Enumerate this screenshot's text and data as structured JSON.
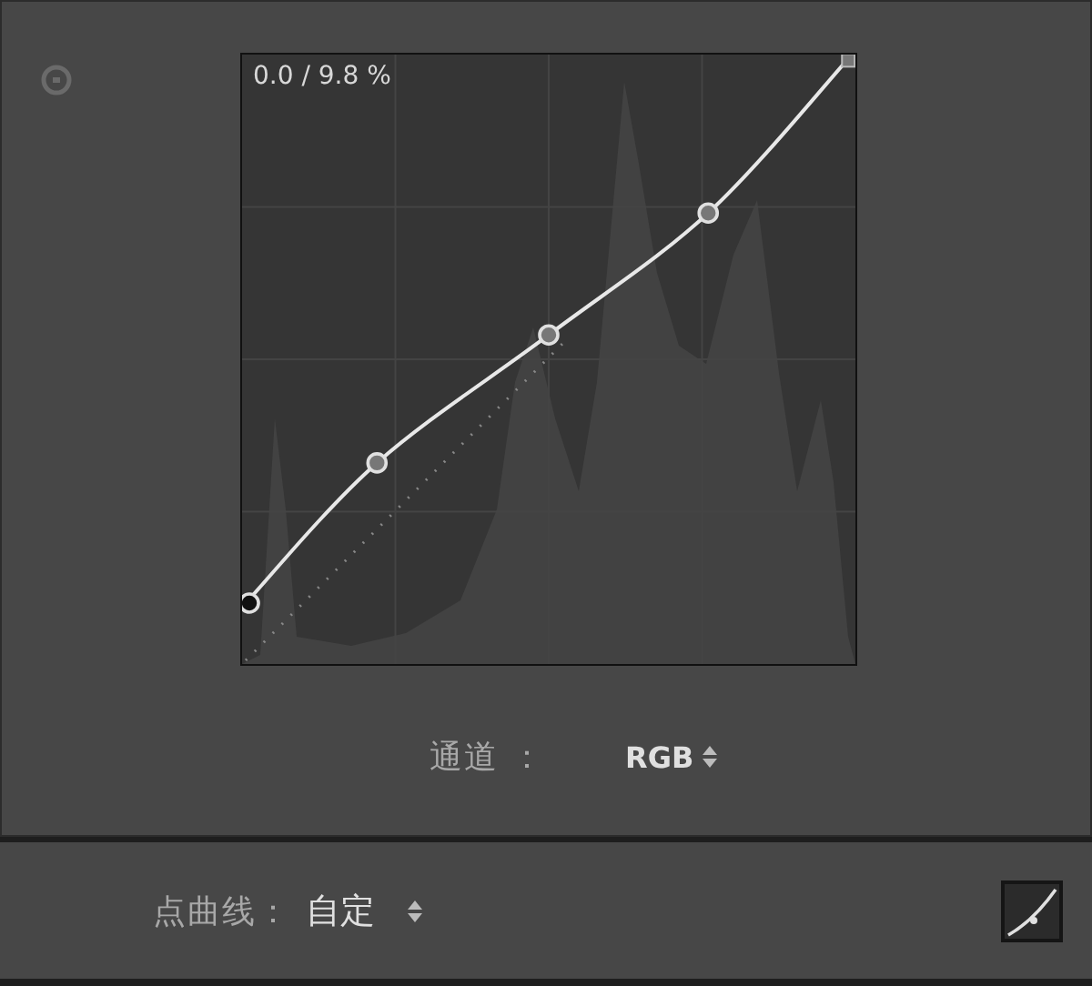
{
  "readout": "0.0 / 9.8 %",
  "channel": {
    "label": "通道 ：",
    "value": "RGB"
  },
  "point_curve": {
    "label": "点曲线：",
    "value": "自定"
  }
}
